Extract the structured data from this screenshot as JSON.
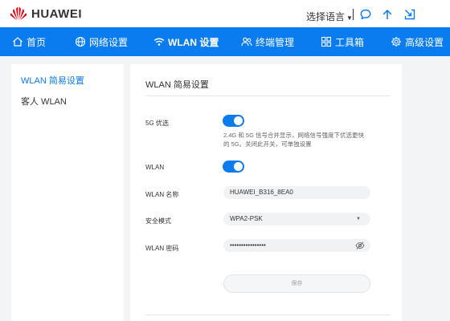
{
  "brand": {
    "name": "HUAWEI"
  },
  "header": {
    "language": "选择语言",
    "icons": [
      "chat-icon",
      "arrow-up-icon",
      "logout-icon"
    ]
  },
  "nav": {
    "items": [
      {
        "label": "首页",
        "icon": "home-icon"
      },
      {
        "label": "网络设置",
        "icon": "globe-icon"
      },
      {
        "label": "WLAN 设置",
        "icon": "wifi-icon",
        "active": true
      },
      {
        "label": "终端管理",
        "icon": "users-icon"
      },
      {
        "label": "工具箱",
        "icon": "toolbox-icon"
      },
      {
        "label": "高级设置",
        "icon": "gear-icon"
      }
    ]
  },
  "sidebar": {
    "items": [
      {
        "label": "WLAN 简易设置",
        "active": true
      },
      {
        "label": "客人 WLAN"
      }
    ]
  },
  "main": {
    "title": "WLAN 简易设置",
    "g5": {
      "label": "5G 优选",
      "enabled": true,
      "hint": "2.4G 和 5G 信号合并显示，网络信号强度下优选更快的 5G。关闭此开关，可单独设置"
    },
    "wlan": {
      "label": "WLAN",
      "enabled": true
    },
    "name": {
      "label": "WLAN 名称",
      "value": "HUAWEI_B316_8EA0"
    },
    "security": {
      "label": "安全模式",
      "value": "WPA2-PSK"
    },
    "password": {
      "label": "WLAN 密码",
      "value": "••••••••••••••••"
    },
    "save_label": "保存"
  },
  "colors": {
    "accent": "#0a7cf0",
    "brand_red": "#e60012"
  }
}
